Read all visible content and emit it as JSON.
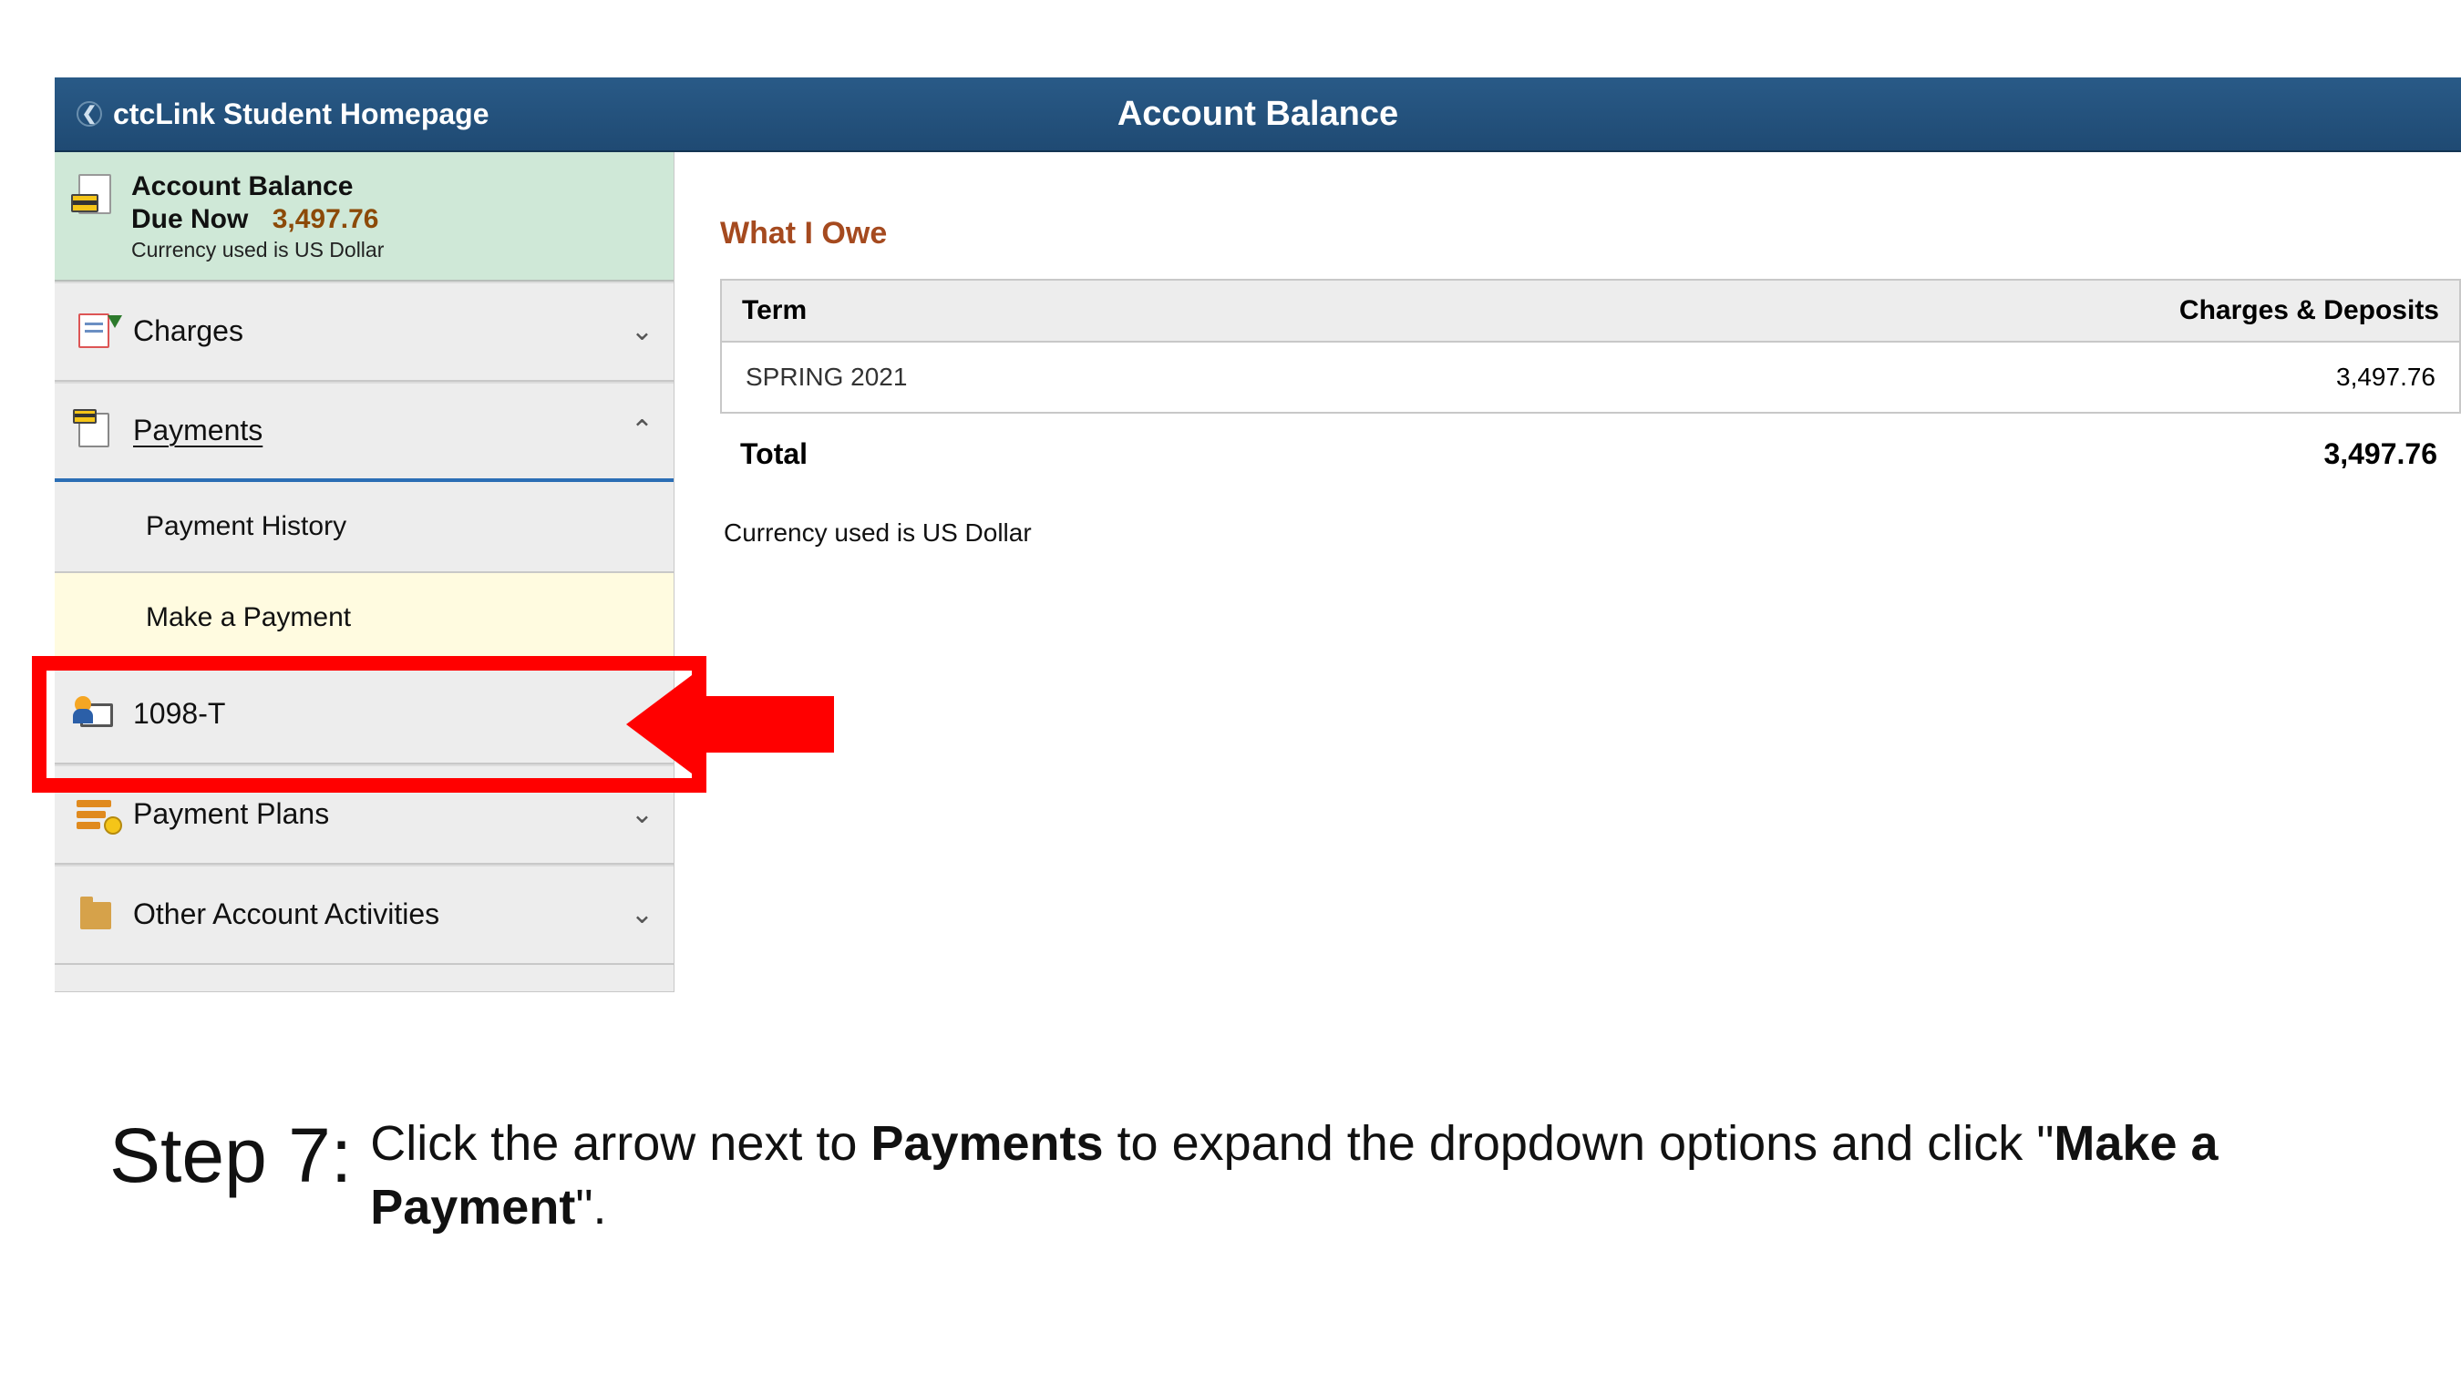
{
  "header": {
    "back_label": "ctcLink Student Homepage",
    "title": "Account Balance"
  },
  "sidebar": {
    "balance": {
      "title": "Account Balance",
      "due_label": "Due Now",
      "due_amount": "3,497.76",
      "currency_note": "Currency used is US Dollar"
    },
    "menu": {
      "charges_label": "Charges",
      "payments_label": "Payments",
      "payment_history_label": "Payment History",
      "make_payment_label": "Make a Payment",
      "t1098_label": "1098-T",
      "plans_label": "Payment Plans",
      "other_label": "Other Account Activities"
    }
  },
  "main": {
    "section_title": "What I Owe",
    "columns": {
      "term": "Term",
      "charges": "Charges & Deposits"
    },
    "rows": [
      {
        "term": "SPRING 2021",
        "amount": "3,497.76"
      }
    ],
    "total_label": "Total",
    "total_amount": "3,497.76",
    "currency_note": "Currency used is US Dollar"
  },
  "instruction": {
    "step_label": "Step 7:",
    "text_pre": "Click the arrow next to ",
    "text_bold1": "Payments",
    "text_mid": " to expand the dropdown options and click \"",
    "text_bold2": "Make a Payment",
    "text_post": "\"."
  }
}
